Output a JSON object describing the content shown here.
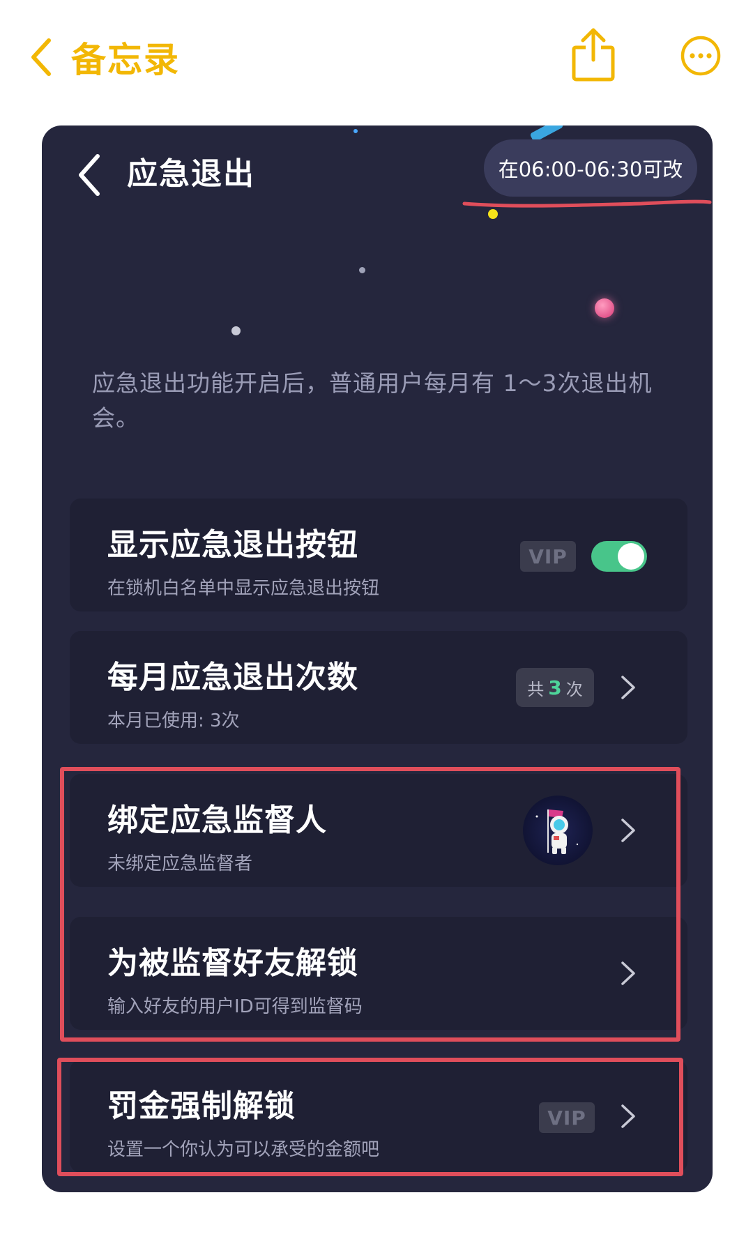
{
  "notes_bar": {
    "back_label": "备忘录",
    "share_icon": "share-icon",
    "more_icon": "more-icon",
    "accent": "#f2b705"
  },
  "app": {
    "title": "应急退出",
    "time_notice": "在06:00-06:30可改",
    "intro": "应急退出功能开启后，普通用户每月有 1～3次退出机会。",
    "card_bg": "#25263d",
    "row_bg": "#1f2034"
  },
  "rows": {
    "show_button": {
      "title": "显示应急退出按钮",
      "subtitle": "在锁机白名单中显示应急退出按钮",
      "vip": "VIP",
      "toggle_on": true
    },
    "monthly_count": {
      "title": "每月应急退出次数",
      "subtitle": "本月已使用: 3次",
      "pill_prefix": "共",
      "pill_num": "3",
      "pill_suffix": "次"
    },
    "bind_supervisor": {
      "title": "绑定应急监督人",
      "subtitle": "未绑定应急监督者",
      "avatar_icon": "astronaut-avatar"
    },
    "unlock_friend": {
      "title": "为被监督好友解锁",
      "subtitle": "输入好友的用户ID可得到监督码"
    },
    "fine_unlock": {
      "title": "罚金强制解锁",
      "subtitle": "设置一个你认为可以承受的金额吧",
      "vip": "VIP"
    }
  },
  "annotation_color": "#e04e5b",
  "toggle_color": "#48c58a"
}
